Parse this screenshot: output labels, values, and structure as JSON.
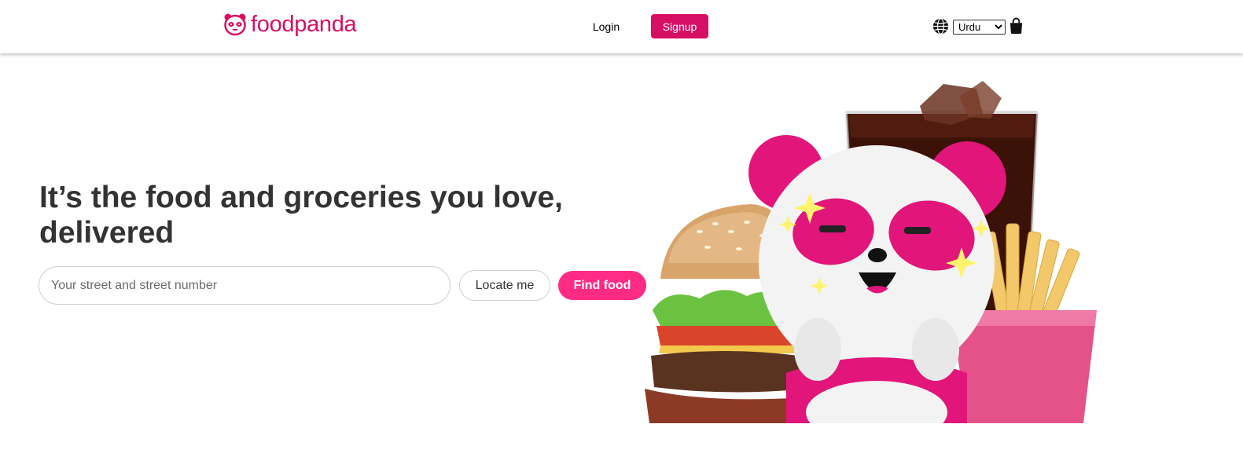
{
  "header": {
    "brand_name": "foodpanda",
    "login_label": "Login",
    "signup_label": "Signup",
    "language": {
      "selected": "Urdu",
      "options": [
        "Urdu"
      ]
    },
    "icons": {
      "logo": "panda-logo-icon",
      "language": "globe-icon",
      "cart": "shopping-bag-icon"
    }
  },
  "hero": {
    "headline": "It’s the food and groceries you love, delivered",
    "address_placeholder": "Your street and street number",
    "address_value": "",
    "locate_label": "Locate me",
    "find_label": "Find food",
    "illustration": "panda-mascot-with-burger-fries-and-cola"
  },
  "colors": {
    "brand": "#d70f64",
    "find_button": "#ff2b85",
    "text": "#333333"
  }
}
